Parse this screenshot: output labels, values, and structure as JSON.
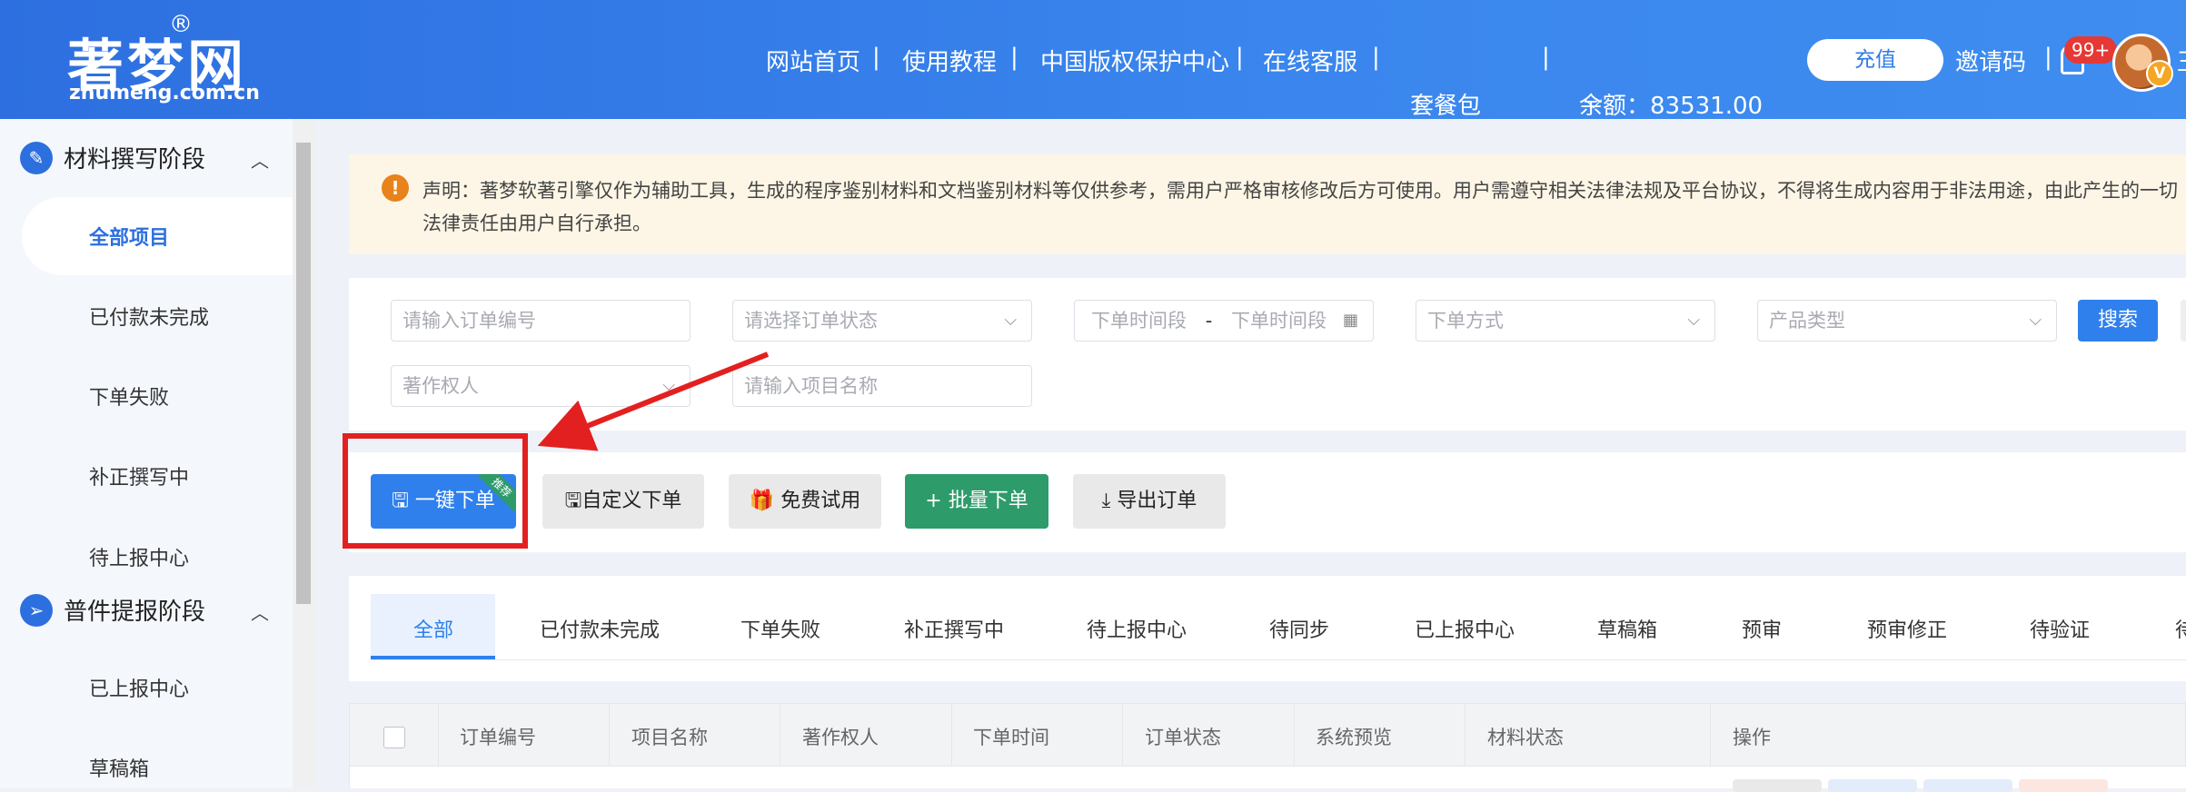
{
  "header": {
    "logo_cn": "著梦网",
    "logo_reg": "®",
    "logo_en": "zhumeng.com.cn",
    "nav": [
      "网站首页",
      "使用教程",
      "中国版权保护中心",
      "在线客服",
      "套餐包"
    ],
    "separator": "|",
    "balance": "余额：83531.00",
    "recharge": "充值",
    "invite": "邀请码",
    "notifications_badge": "99+",
    "vip_badge": "V",
    "user_clip": "王"
  },
  "sidebar": {
    "sections": [
      {
        "label": "材料撰写阶段",
        "items": [
          "全部项目",
          "已付款未完成",
          "下单失败",
          "补正撰写中",
          "待上报中心"
        ]
      },
      {
        "label": "普件提报阶段",
        "items": [
          "已上报中心",
          "草稿箱"
        ]
      }
    ],
    "active_item": "全部项目"
  },
  "notice": {
    "icon": "!",
    "text": "声明：著梦软著引擎仅作为辅助工具，生成的程序鉴别材料和文档鉴别材料等仅供参考，需用户严格审核修改后方可使用。用户需遵守相关法律法规及平台协议，不得将生成内容用于非法用途，由此产生的一切法律责任由用户自行承担。"
  },
  "filters": {
    "order_no_placeholder": "请输入订单编号",
    "order_status_placeholder": "请选择订单状态",
    "date_start_placeholder": "下单时间段",
    "date_separator": "-",
    "date_end_placeholder": "下单时间段",
    "order_method_placeholder": "下单方式",
    "product_type_placeholder": "产品类型",
    "copyright_owner_placeholder": "著作权人",
    "project_name_placeholder": "请输入项目名称",
    "search": "搜索"
  },
  "actions": {
    "one_click_order": "一键下单",
    "recommended_tag": "推荐",
    "custom_order": "自定义下单",
    "free_trial": "免费试用",
    "batch_order": "+ 批量下单",
    "export_orders": "导出订单"
  },
  "tabs": [
    "全部",
    "已付款未完成",
    "下单失败",
    "补正撰写中",
    "待上报中心",
    "待同步",
    "已上报中心",
    "草稿箱",
    "预审",
    "预审修正",
    "待验证",
    "待"
  ],
  "table": {
    "columns": [
      "订单编号",
      "项目名称",
      "著作权人",
      "下单时间",
      "订单状态",
      "系统预览",
      "材料状态",
      "操作"
    ]
  },
  "colors": {
    "header_blue": "#2d6fe0",
    "primary": "#2f80ed",
    "green": "#2e9b6a",
    "highlight_red": "#e32020",
    "notice_bg": "#fdf6e6"
  }
}
